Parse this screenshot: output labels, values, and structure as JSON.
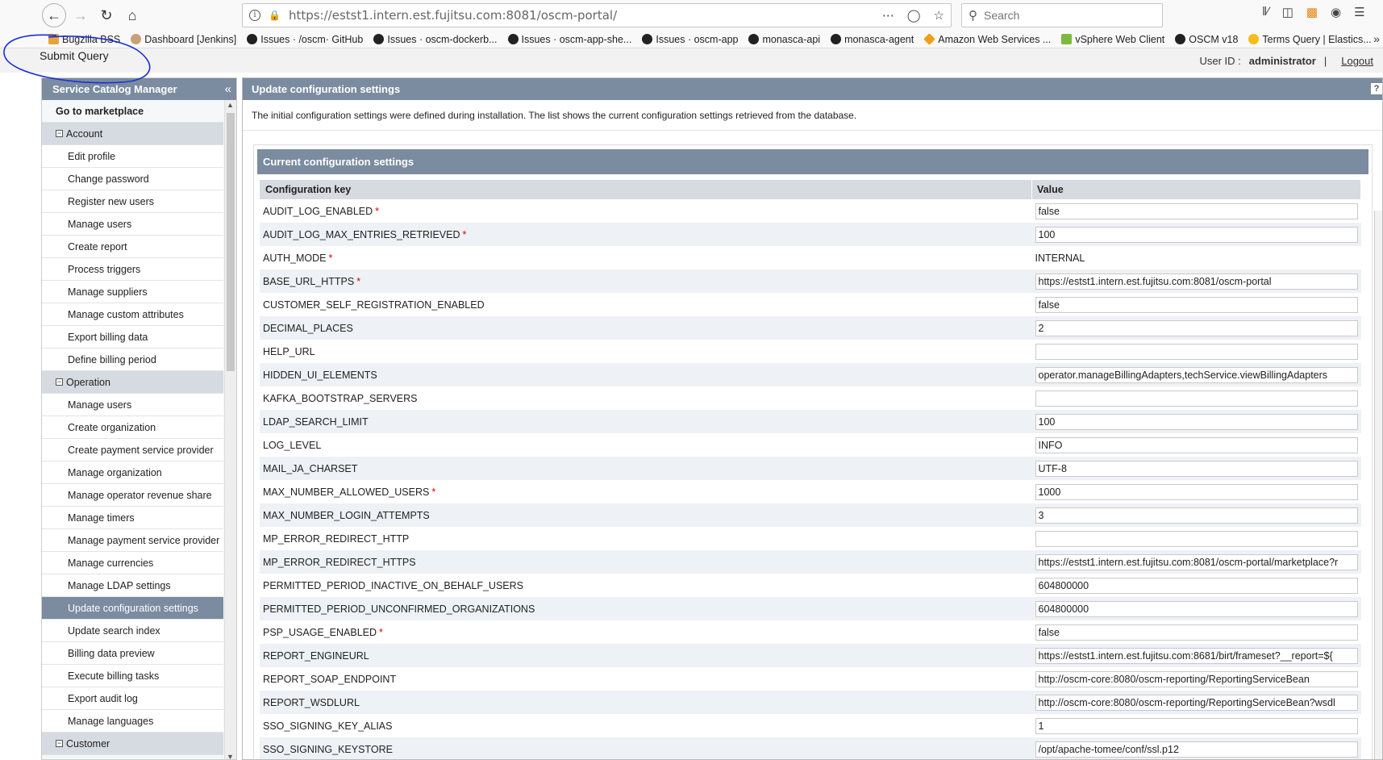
{
  "browser": {
    "url": "https://estst1.intern.est.fujitsu.com:8081/oscm-portal/",
    "search_placeholder": "Search",
    "bookmarks": [
      {
        "label": "Bugzilla BSS",
        "icon": "bugzilla-icon"
      },
      {
        "label": "Dashboard [Jenkins]",
        "icon": "jenkins-icon"
      },
      {
        "label": "Issues · /oscm· GitHub",
        "icon": "github-icon"
      },
      {
        "label": "Issues · oscm-dockerb...",
        "icon": "github-icon"
      },
      {
        "label": "Issues · oscm-app-she...",
        "icon": "github-icon"
      },
      {
        "label": "Issues · oscm-app",
        "icon": "github-icon"
      },
      {
        "label": "monasca-api",
        "icon": "github-icon"
      },
      {
        "label": "monasca-agent",
        "icon": "github-icon"
      },
      {
        "label": "Amazon Web Services ...",
        "icon": "aws-icon"
      },
      {
        "label": "vSphere Web Client",
        "icon": "vsphere-icon"
      },
      {
        "label": "OSCM v18",
        "icon": "github-icon"
      },
      {
        "label": "Terms Query | Elastics...",
        "icon": "elastic-icon"
      }
    ]
  },
  "header": {
    "submit_label": "Submit Query",
    "user_label": "User ID :",
    "user_id": "administrator",
    "separator": "|",
    "logout": "Logout"
  },
  "sidebar": {
    "title": "Service Catalog Manager",
    "collapse": "«",
    "items": [
      {
        "label": "Go to marketplace",
        "kind": "top"
      },
      {
        "label": "Account",
        "kind": "section"
      },
      {
        "label": "Edit profile",
        "kind": "item"
      },
      {
        "label": "Change password",
        "kind": "item"
      },
      {
        "label": "Register new users",
        "kind": "item"
      },
      {
        "label": "Manage users",
        "kind": "item"
      },
      {
        "label": "Create report",
        "kind": "item"
      },
      {
        "label": "Process triggers",
        "kind": "item"
      },
      {
        "label": "Manage suppliers",
        "kind": "item"
      },
      {
        "label": "Manage custom attributes",
        "kind": "item"
      },
      {
        "label": "Export billing data",
        "kind": "item"
      },
      {
        "label": "Define billing period",
        "kind": "item"
      },
      {
        "label": "Operation",
        "kind": "section"
      },
      {
        "label": "Manage users",
        "kind": "item"
      },
      {
        "label": "Create organization",
        "kind": "item"
      },
      {
        "label": "Create payment service provider",
        "kind": "item"
      },
      {
        "label": "Manage organization",
        "kind": "item"
      },
      {
        "label": "Manage operator revenue share",
        "kind": "item"
      },
      {
        "label": "Manage timers",
        "kind": "item"
      },
      {
        "label": "Manage payment service provider",
        "kind": "item"
      },
      {
        "label": "Manage currencies",
        "kind": "item"
      },
      {
        "label": "Manage LDAP settings",
        "kind": "item"
      },
      {
        "label": "Update configuration settings",
        "kind": "active"
      },
      {
        "label": "Update search index",
        "kind": "item"
      },
      {
        "label": "Billing data preview",
        "kind": "item"
      },
      {
        "label": "Execute billing tasks",
        "kind": "item"
      },
      {
        "label": "Export audit log",
        "kind": "item"
      },
      {
        "label": "Manage languages",
        "kind": "item"
      },
      {
        "label": "Customer",
        "kind": "section"
      }
    ]
  },
  "main": {
    "title": "Update configuration settings",
    "help": "?",
    "intro": "The initial configuration settings were defined during installation. The list shows the current configuration settings retrieved from the database.",
    "section_title": "Current configuration settings",
    "columns": {
      "key": "Configuration key",
      "value": "Value"
    },
    "rows": [
      {
        "key": "AUDIT_LOG_ENABLED",
        "required": true,
        "value": "false",
        "editable": true
      },
      {
        "key": "AUDIT_LOG_MAX_ENTRIES_RETRIEVED",
        "required": true,
        "value": "100",
        "editable": true
      },
      {
        "key": "AUTH_MODE",
        "required": true,
        "value": "INTERNAL",
        "editable": false
      },
      {
        "key": "BASE_URL_HTTPS",
        "required": true,
        "value": "https://estst1.intern.est.fujitsu.com:8081/oscm-portal",
        "editable": true
      },
      {
        "key": "CUSTOMER_SELF_REGISTRATION_ENABLED",
        "required": false,
        "value": "false",
        "editable": true
      },
      {
        "key": "DECIMAL_PLACES",
        "required": false,
        "value": "2",
        "editable": true
      },
      {
        "key": "HELP_URL",
        "required": false,
        "value": "",
        "editable": true
      },
      {
        "key": "HIDDEN_UI_ELEMENTS",
        "required": false,
        "value": "operator.manageBillingAdapters,techService.viewBillingAdapters",
        "editable": true
      },
      {
        "key": "KAFKA_BOOTSTRAP_SERVERS",
        "required": false,
        "value": "",
        "editable": true
      },
      {
        "key": "LDAP_SEARCH_LIMIT",
        "required": false,
        "value": "100",
        "editable": true
      },
      {
        "key": "LOG_LEVEL",
        "required": false,
        "value": "INFO",
        "editable": true
      },
      {
        "key": "MAIL_JA_CHARSET",
        "required": false,
        "value": "UTF-8",
        "editable": true
      },
      {
        "key": "MAX_NUMBER_ALLOWED_USERS",
        "required": true,
        "value": "1000",
        "editable": true
      },
      {
        "key": "MAX_NUMBER_LOGIN_ATTEMPTS",
        "required": false,
        "value": "3",
        "editable": true
      },
      {
        "key": "MP_ERROR_REDIRECT_HTTP",
        "required": false,
        "value": "",
        "editable": true
      },
      {
        "key": "MP_ERROR_REDIRECT_HTTPS",
        "required": false,
        "value": "https://estst1.intern.est.fujitsu.com:8081/oscm-portal/marketplace?r",
        "editable": true
      },
      {
        "key": "PERMITTED_PERIOD_INACTIVE_ON_BEHALF_USERS",
        "required": false,
        "value": "604800000",
        "editable": true
      },
      {
        "key": "PERMITTED_PERIOD_UNCONFIRMED_ORGANIZATIONS",
        "required": false,
        "value": "604800000",
        "editable": true
      },
      {
        "key": "PSP_USAGE_ENABLED",
        "required": true,
        "value": "false",
        "editable": true
      },
      {
        "key": "REPORT_ENGINEURL",
        "required": false,
        "value": "https://estst1.intern.est.fujitsu.com:8681/birt/frameset?__report=${",
        "editable": true
      },
      {
        "key": "REPORT_SOAP_ENDPOINT",
        "required": false,
        "value": "http://oscm-core:8080/oscm-reporting/ReportingServiceBean",
        "editable": true
      },
      {
        "key": "REPORT_WSDLURL",
        "required": false,
        "value": "http://oscm-core:8080/oscm-reporting/ReportingServiceBean?wsdl",
        "editable": true
      },
      {
        "key": "SSO_SIGNING_KEY_ALIAS",
        "required": false,
        "value": "1",
        "editable": true
      },
      {
        "key": "SSO_SIGNING_KEYSTORE",
        "required": false,
        "value": "/opt/apache-tomee/conf/ssl.p12",
        "editable": true
      }
    ]
  },
  "colors": {
    "panel_header": "#7b8ba0",
    "row_alt": "#eef1f5",
    "required_marker": "#dd0000",
    "annotation": "#1a2fd6"
  }
}
